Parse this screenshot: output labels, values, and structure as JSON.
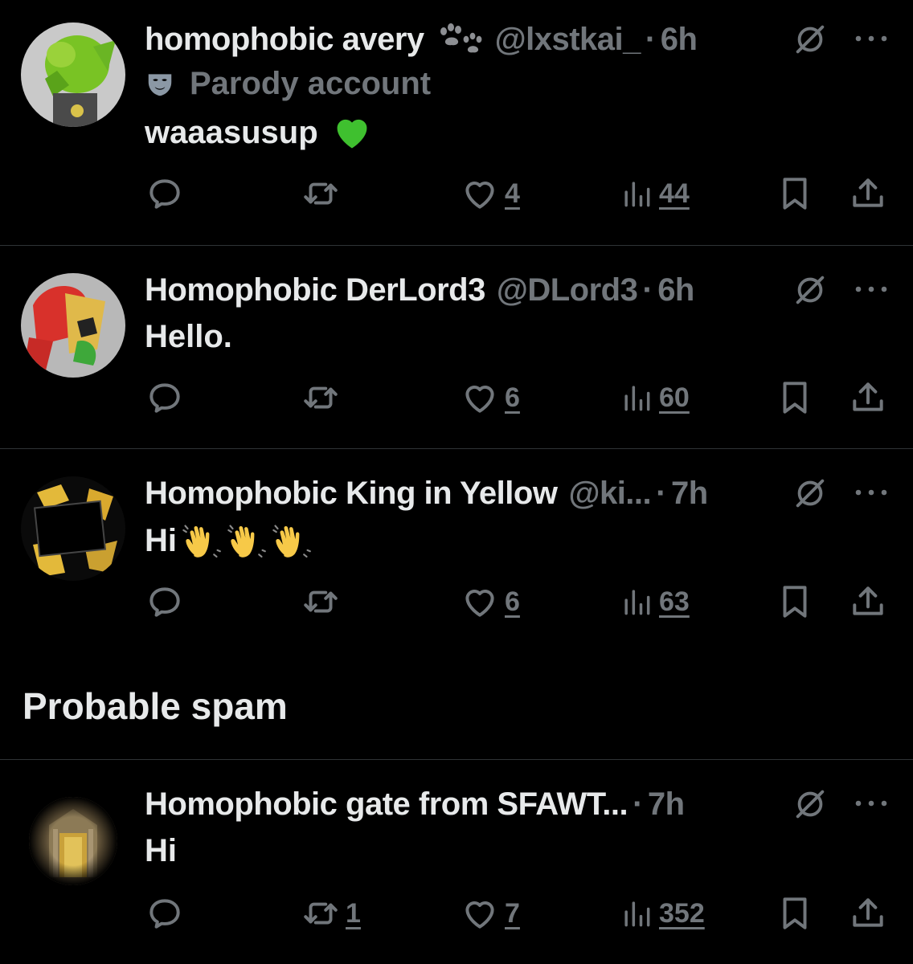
{
  "tweets": [
    {
      "name": "homophobic avery",
      "handle": "@lxstkai_",
      "dot": "·",
      "time": "6h",
      "parody_label": "Parody account",
      "text": "waaasusup",
      "emoji": "green-heart",
      "reposts": "",
      "likes": "4",
      "views": "44"
    },
    {
      "name": "Homophobic DerLord3",
      "handle": "@DLord3",
      "dot": "·",
      "time": "6h",
      "text": "Hello.",
      "reposts": "",
      "likes": "6",
      "views": "60"
    },
    {
      "name": "Homophobic King in Yellow",
      "handle": "@ki...",
      "dot": "·",
      "time": "7h",
      "text": "Hi",
      "emoji": "waving-hand x3",
      "reposts": "",
      "likes": "6",
      "views": "63"
    },
    {
      "name": "Homophobic gate from SFAWT...",
      "handle": "",
      "dot": "·",
      "time": "7h",
      "text": "Hi",
      "reposts": "1",
      "likes": "7",
      "views": "352"
    }
  ],
  "section": {
    "title": "Probable spam"
  },
  "colors": {
    "background": "#000000",
    "text": "#e7e9ea",
    "muted": "#71767b",
    "divider": "#2f3336"
  },
  "icons": [
    "reply-icon",
    "repost-icon",
    "like-icon",
    "views-icon",
    "bookmark-icon",
    "share-icon",
    "grok-icon",
    "more-icon",
    "paw-icon",
    "parody-mask-icon"
  ]
}
